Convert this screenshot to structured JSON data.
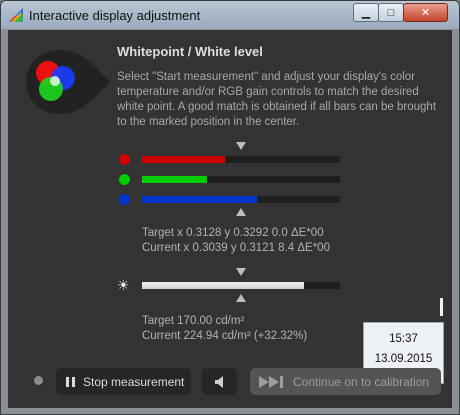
{
  "window": {
    "title": "Interactive display adjustment",
    "minimize_label": "▁",
    "maximize_label": "□",
    "close_label": "✕"
  },
  "panel": {
    "heading": "Whitepoint / White level",
    "description": "Select \"Start measurement\" and adjust your display's color temperature and/or RGB gain controls to match the desired white point. A good match is obtained if all bars can be brought to the marked position in the center."
  },
  "bars": [
    {
      "channel": "red",
      "color": "#cc0000",
      "level": 0.42
    },
    {
      "channel": "green",
      "color": "#00cc00",
      "level": 0.33
    },
    {
      "channel": "blue",
      "color": "#0033cc",
      "level": 0.58
    }
  ],
  "whitepoint": {
    "target": "Target x 0.3128 y 0.3292 0.0 ΔE*00",
    "current": "Current x 0.3039 y 0.3121 8.4 ΔE*00"
  },
  "luminance": {
    "level": 0.82,
    "target": "Target 170.00 cd/m²",
    "current": "Current 224.94 cd/m² (+32.32%)"
  },
  "clock": {
    "time": "15:37",
    "date": "13.09.2015"
  },
  "buttons": {
    "stop": "Stop measurement",
    "continue": "Continue on to calibration"
  },
  "colors": {
    "panel_bg": "#333333",
    "button_bg": "#262626",
    "accent_red": "#cc0000",
    "accent_green": "#00cc00",
    "accent_blue": "#0033cc"
  }
}
